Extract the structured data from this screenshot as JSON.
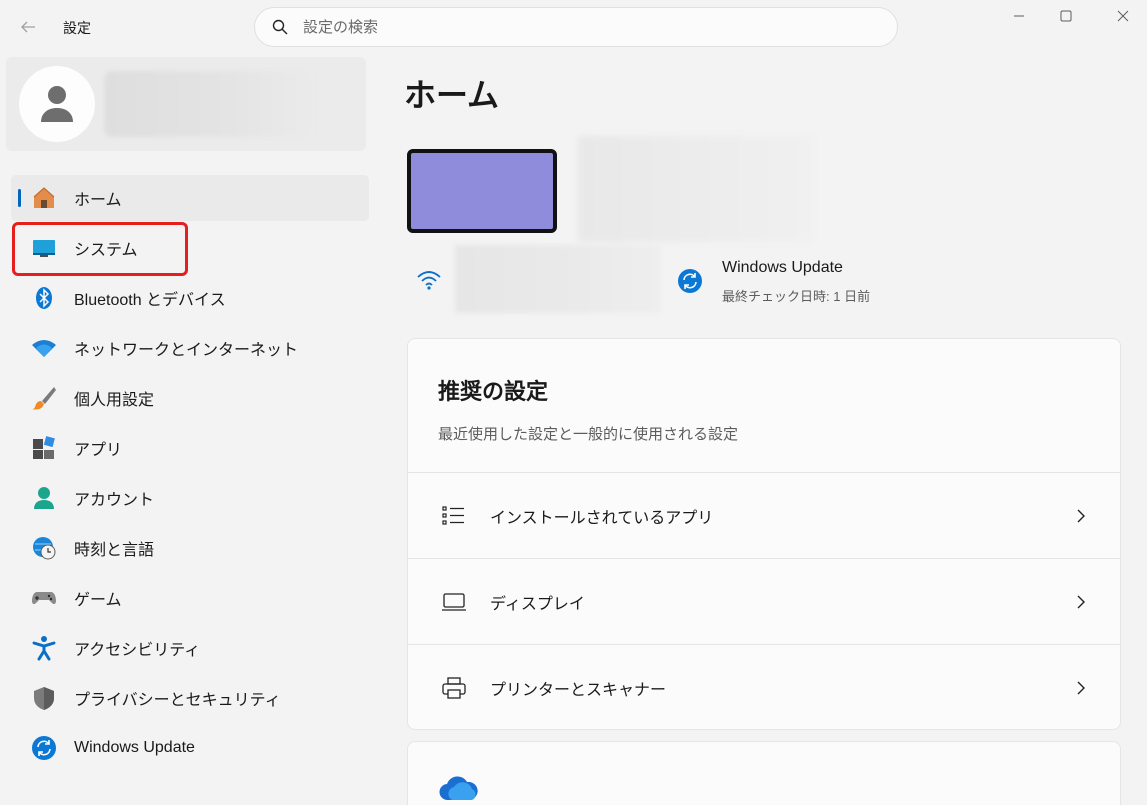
{
  "titlebar": {
    "app_title": "設定",
    "search_placeholder": "設定の検索",
    "back_icon": "back-arrow-icon",
    "minimize_icon": "minimize-icon",
    "maximize_icon": "maximize-icon",
    "close_icon": "close-icon"
  },
  "sidebar": {
    "items": [
      {
        "label": "ホーム",
        "icon": "home-icon",
        "active": true
      },
      {
        "label": "システム",
        "icon": "system-icon",
        "active": false
      },
      {
        "label": "Bluetooth とデバイス",
        "icon": "bluetooth-icon",
        "active": false
      },
      {
        "label": "ネットワークとインターネット",
        "icon": "network-icon",
        "active": false
      },
      {
        "label": "個人用設定",
        "icon": "brush-icon",
        "active": false
      },
      {
        "label": "アプリ",
        "icon": "apps-icon",
        "active": false
      },
      {
        "label": "アカウント",
        "icon": "account-icon",
        "active": false
      },
      {
        "label": "時刻と言語",
        "icon": "time-language-icon",
        "active": false
      },
      {
        "label": "ゲーム",
        "icon": "gamepad-icon",
        "active": false
      },
      {
        "label": "アクセシビリティ",
        "icon": "accessibility-icon",
        "active": false
      },
      {
        "label": "プライバシーとセキュリティ",
        "icon": "shield-icon",
        "active": false
      },
      {
        "label": "Windows Update",
        "icon": "windows-update-icon",
        "active": false
      }
    ]
  },
  "main": {
    "title": "ホーム",
    "windows_update": {
      "title": "Windows Update",
      "subtitle": "最終チェック日時: 1 日前"
    },
    "recommended": {
      "title": "推奨の設定",
      "subtitle": "最近使用した設定と一般的に使用される設定",
      "rows": [
        {
          "label": "インストールされているアプリ",
          "icon": "installed-apps-icon"
        },
        {
          "label": "ディスプレイ",
          "icon": "display-icon"
        },
        {
          "label": "プリンターとスキャナー",
          "icon": "printer-icon"
        }
      ]
    }
  },
  "colors": {
    "accent": "#0067c0",
    "highlight": "#e61e1e",
    "device_thumb": "#8f8cdb"
  }
}
